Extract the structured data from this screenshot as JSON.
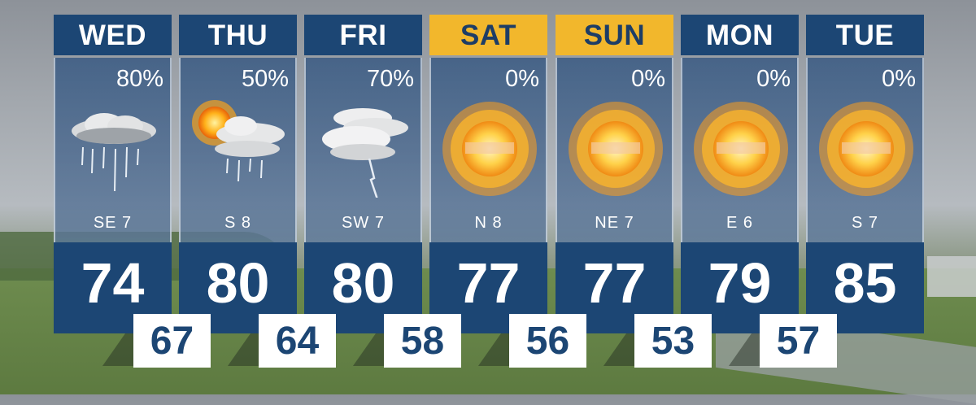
{
  "forecast": {
    "days": [
      {
        "day": "WED",
        "precip": "80%",
        "wind": "SE  7",
        "high": "74",
        "condition": "rain-cloud-icon",
        "weekend": false
      },
      {
        "day": "THU",
        "precip": "50%",
        "wind": "S    8",
        "high": "80",
        "condition": "sun-cloud-rain-icon",
        "weekend": false
      },
      {
        "day": "FRI",
        "precip": "70%",
        "wind": "SW  7",
        "high": "80",
        "condition": "thunderstorm-icon",
        "weekend": false
      },
      {
        "day": "SAT",
        "precip": "0%",
        "wind": "N    8",
        "high": "77",
        "condition": "sun-icon",
        "weekend": true
      },
      {
        "day": "SUN",
        "precip": "0%",
        "wind": "NE  7",
        "high": "77",
        "condition": "sun-icon",
        "weekend": true
      },
      {
        "day": "MON",
        "precip": "0%",
        "wind": "E  6",
        "high": "79",
        "condition": "sun-icon",
        "weekend": false
      },
      {
        "day": "TUE",
        "precip": "0%",
        "wind": "S  7",
        "high": "85",
        "condition": "sun-icon",
        "weekend": false
      }
    ],
    "lows": [
      "67",
      "64",
      "58",
      "56",
      "53",
      "57"
    ]
  },
  "colors": {
    "header_blue": "#1c4674",
    "weekend_gold": "#f2b72c",
    "low_text": "#1c4674"
  }
}
